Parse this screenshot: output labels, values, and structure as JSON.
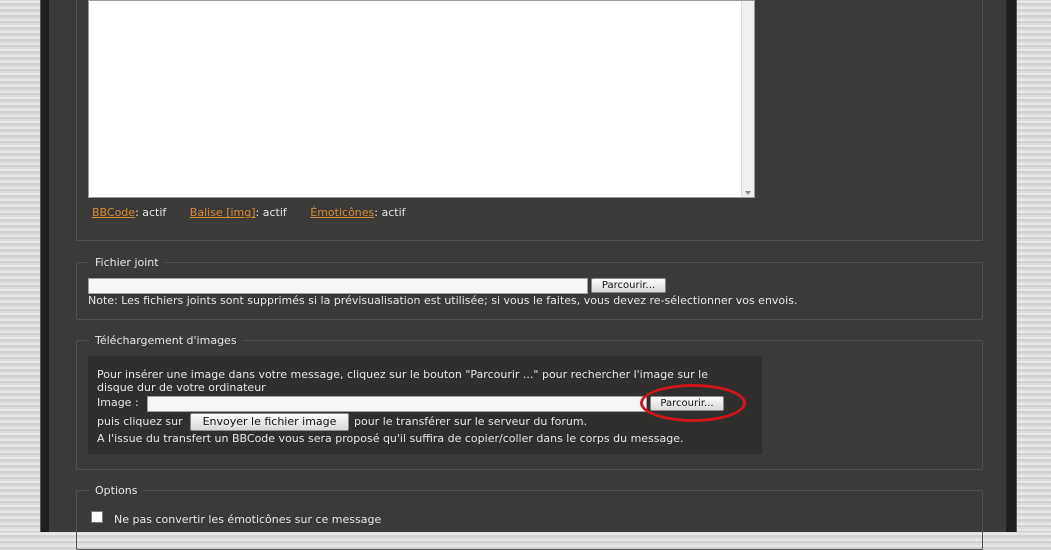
{
  "editor": {
    "status": {
      "bbcode_link": "BBCode",
      "bbcode_state": ": actif",
      "img_link": "Balise [img]",
      "img_state": ": actif",
      "emot_link": "Émoticônes",
      "emot_state": ": actif"
    }
  },
  "attachment": {
    "legend": "Fichier joint",
    "browse_label": "Parcourir...",
    "note": "Note: Les fichiers joints sont supprimés si la prévisualisation est utilisée; si vous le faites, vous devez re-sélectionner vos envois."
  },
  "image_upload": {
    "legend": "Téléchargement d'images",
    "instructions_line1": "Pour insérer une image dans votre message, cliquez sur le bouton \"Parcourir ...\" pour rechercher l'image sur le",
    "instructions_line2": "disque dur de votre ordinateur",
    "image_label": "Image :",
    "browse_label": "Parcourir...",
    "then_click": "puis cliquez sur",
    "send_button": "Envoyer le fichier image",
    "after_send": "pour le transférer sur le serveur du forum.",
    "footer": "A l'issue du transfert un BBCode vous sera proposé qu'il suffira de copier/coller dans le corps du message."
  },
  "options": {
    "legend": "Options",
    "disable_emoticons": "Ne pas convertir les émoticônes sur ce message"
  },
  "colors": {
    "accent_link": "#d98a33",
    "highlight_ring": "#d4141b"
  }
}
